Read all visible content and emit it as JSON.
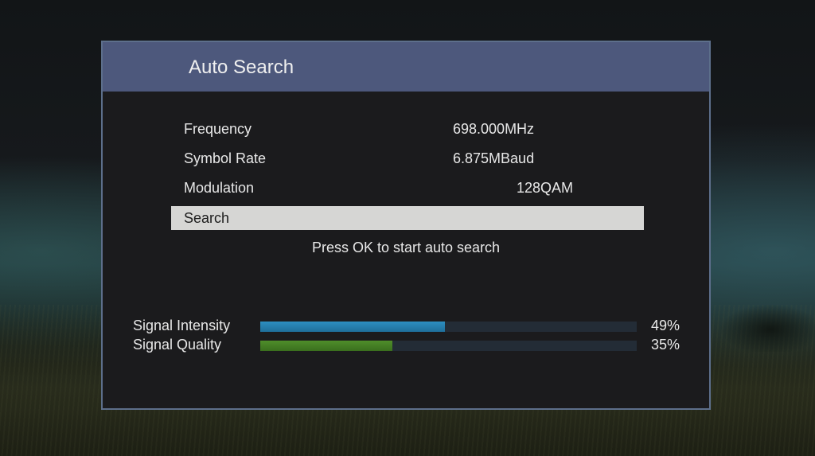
{
  "dialog": {
    "title": "Auto Search",
    "rows": [
      {
        "label": "Frequency",
        "value": "698.000MHz"
      },
      {
        "label": "Symbol Rate",
        "value": "6.875MBaud"
      },
      {
        "label": "Modulation",
        "value": "128QAM"
      },
      {
        "label": "Search",
        "value": ""
      }
    ],
    "hint": "Press OK to start auto search"
  },
  "signal": {
    "intensity": {
      "label": "Signal Intensity",
      "percent_text": "49%",
      "level": 0.49,
      "color": "#2d8ec0"
    },
    "quality": {
      "label": "Signal Quality",
      "percent_text": "35%",
      "level": 0.35,
      "color": "#4f8e2a"
    }
  },
  "colors": {
    "header": "#4d587c",
    "border": "#5d6f8b",
    "highlight": "#d6d6d4"
  }
}
